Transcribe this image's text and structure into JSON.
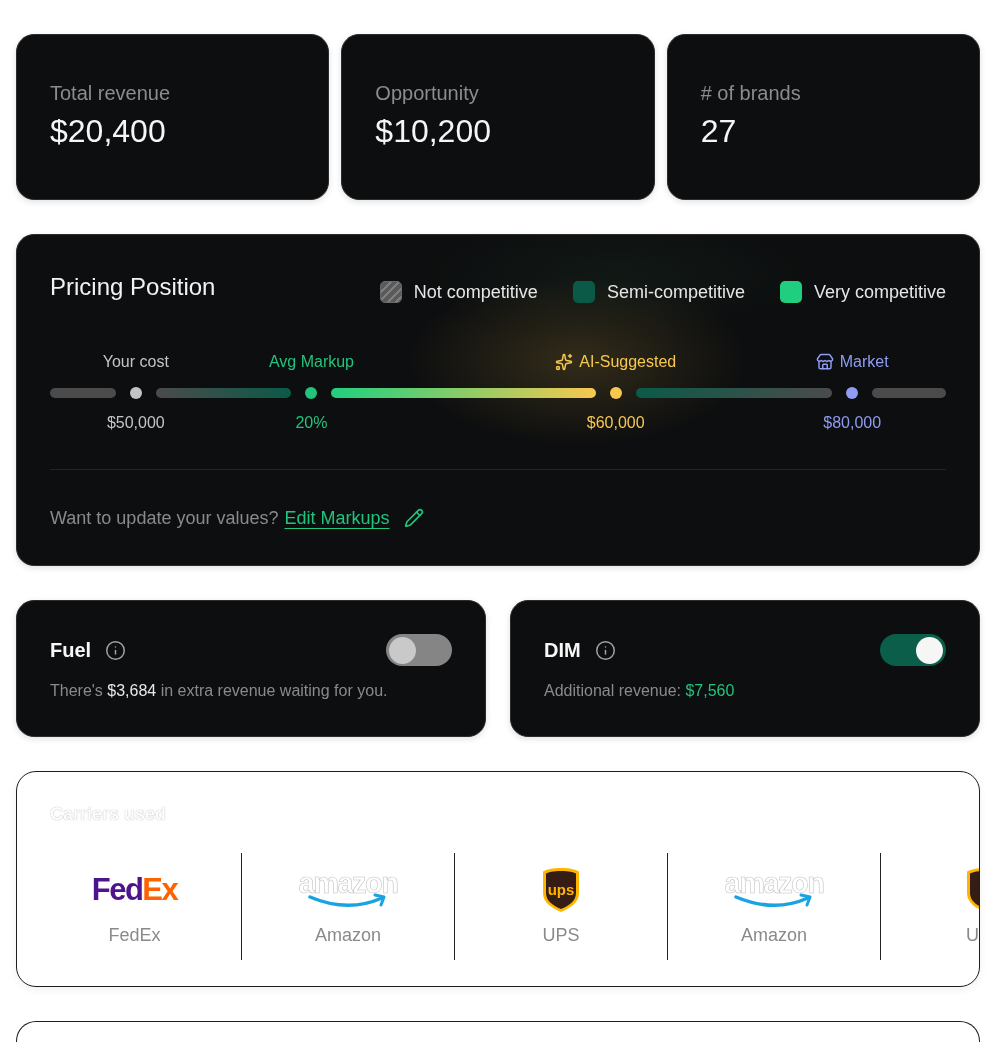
{
  "stats": [
    {
      "label": "Total revenue",
      "value": "$20,400"
    },
    {
      "label": "Opportunity",
      "value": "$10,200"
    },
    {
      "label": "# of brands",
      "value": "27"
    }
  ],
  "pricing": {
    "title": "Pricing Position",
    "legend": [
      {
        "label": "Not competitive",
        "color": "#5a5a5a",
        "kind": "striped"
      },
      {
        "label": "Semi-competitive",
        "color": "#0b5a48",
        "kind": "solid"
      },
      {
        "label": "Very competitive",
        "color": "#1fcf7f",
        "kind": "solid"
      }
    ],
    "markers": [
      {
        "kind": "cost",
        "label": "Your cost",
        "value": "$50,000",
        "color": "#c4c4c4"
      },
      {
        "kind": "markup",
        "label": "Avg Markup",
        "value": "20%",
        "color": "#22c37c"
      },
      {
        "kind": "ai",
        "label": "AI-Suggested",
        "value": "$60,000",
        "color": "#f7c850"
      },
      {
        "kind": "market",
        "label": "Market",
        "value": "$80,000",
        "color": "#8f9cf2"
      }
    ],
    "prompt": "Want to update your values?",
    "link": "Edit Markups"
  },
  "toggles": [
    {
      "title": "Fuel",
      "on": false,
      "prefix": "There's ",
      "amount": "$3,684",
      "suffix": " in extra revenue waiting for you."
    },
    {
      "title": "DIM",
      "on": true,
      "prefix": "Additional revenue: ",
      "amount": "$7,560"
    }
  ],
  "carriers": {
    "title": "Carriers used",
    "items": [
      {
        "kind": "fedex",
        "clipped": false,
        "logo": [
          "Fed",
          "Ex"
        ],
        "name": "FedEx"
      },
      {
        "kind": "amazon",
        "clipped": false,
        "logo": [
          "amazon"
        ],
        "name": "Amazon"
      },
      {
        "kind": "ups",
        "clipped": false,
        "logo": [
          "ups"
        ],
        "name": "UPS"
      },
      {
        "kind": "amazon",
        "clipped": false,
        "logo": [
          "amazon"
        ],
        "name": "Amazon"
      },
      {
        "kind": "ups",
        "clipped": true,
        "name": "U"
      }
    ]
  }
}
